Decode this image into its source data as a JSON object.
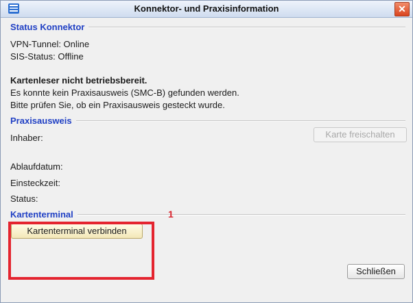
{
  "window": {
    "title": "Konnektor- und Praxisinformation"
  },
  "status_konnektor": {
    "heading": "Status Konnektor",
    "vpn": "VPN-Tunnel: Online",
    "sis": "SIS-Status: Offline"
  },
  "message": {
    "title": "Kartenleser nicht betriebsbereit.",
    "line1": "Es konnte kein Praxisausweis (SMC-B) gefunden werden.",
    "line2": "Bitte prüfen Sie, ob ein Praxisausweis gesteckt wurde."
  },
  "praxisausweis": {
    "heading": "Praxisausweis",
    "inhaber_label": "Inhaber:",
    "unlock_button": "Karte freischalten",
    "ablaufdatum_label": "Ablaufdatum:",
    "einsteckzeit_label": "Einsteckzeit:",
    "status_label": "Status:"
  },
  "kartenterminal": {
    "heading": "Kartenterminal",
    "connect_button": "Kartenterminal verbinden"
  },
  "footer": {
    "close_button": "Schließen"
  },
  "annotation": {
    "number": "1",
    "color": "#e4242f"
  },
  "colors": {
    "heading": "#1f3fc4",
    "close_bg": "#d9441f"
  }
}
